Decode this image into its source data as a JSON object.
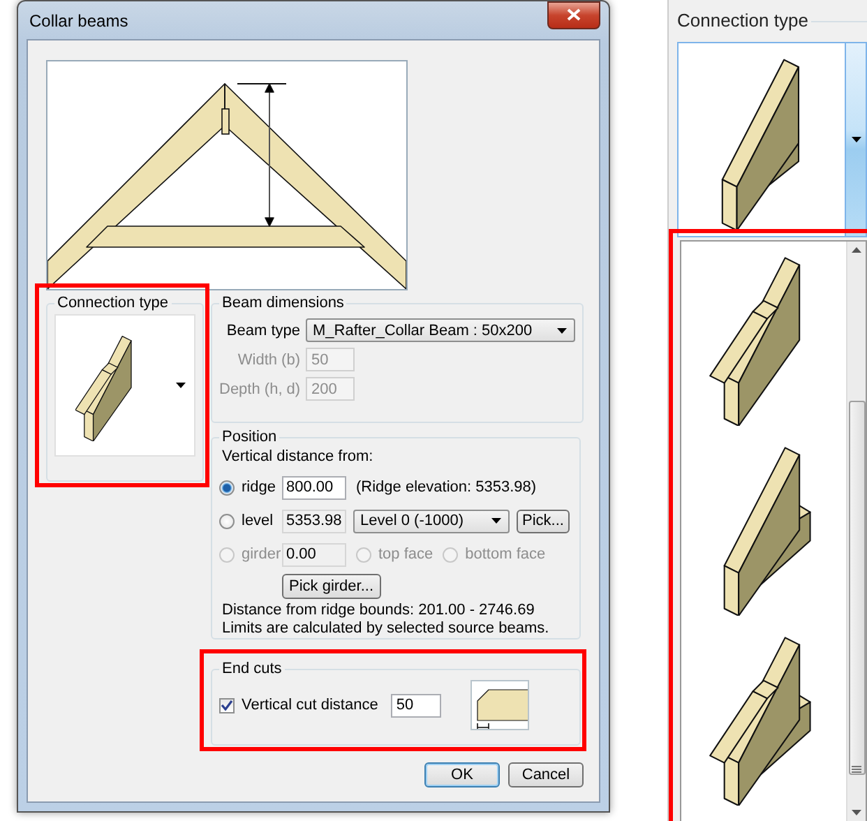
{
  "dialog": {
    "title": "Collar beams",
    "connection_type": {
      "title": "Connection type",
      "kind": "side-block",
      "highlighted": true
    },
    "beam_dimensions": {
      "title": "Beam dimensions",
      "fields": [
        {
          "label": "Beam type",
          "value": "M_Rafter_Collar Beam : 50x200",
          "kind": "dropdown",
          "disabled": false
        },
        {
          "label": "Width (b)",
          "value": "50",
          "kind": "text",
          "disabled": true
        },
        {
          "label": "Depth (h, d)",
          "value": "200",
          "kind": "text",
          "disabled": true
        }
      ]
    },
    "position": {
      "title": "Position",
      "subtitle": "Vertical distance from:",
      "options": [
        {
          "label": "ridge",
          "selected": true,
          "disabled": false,
          "value": "800.00",
          "editable": true,
          "note": "(Ridge elevation: 5353.98)"
        },
        {
          "label": "level",
          "selected": false,
          "disabled": false,
          "value": "5353.98",
          "editable": false,
          "dropdown": "Level 0 (-1000)",
          "button": "Pick..."
        },
        {
          "label": "girder",
          "selected": false,
          "disabled": true,
          "value": "0.00",
          "editable": false,
          "faces": [
            {
              "label": "top face",
              "selected": false,
              "disabled": true
            },
            {
              "label": "bottom face",
              "selected": false,
              "disabled": true
            }
          ]
        }
      ],
      "pick_button": "Pick girder...",
      "bounds": "Distance from ridge bounds: 201.00 - 2746.69",
      "limits_note": "Limits are calculated by selected source beams."
    },
    "end_cuts": {
      "title": "End cuts",
      "highlighted": true,
      "checkbox": {
        "label": "Vertical cut distance",
        "checked": true
      },
      "value": "50"
    },
    "buttons": [
      {
        "label": "OK",
        "default": true
      },
      {
        "label": "Cancel",
        "default": false
      }
    ]
  },
  "connection_panel": {
    "title": "Connection type",
    "current": {
      "kind": "back-wedge"
    },
    "list_highlighted": true,
    "options": [
      {
        "kind": "side-block"
      },
      {
        "kind": "wedge-block"
      },
      {
        "kind": "wedge-double"
      }
    ]
  }
}
